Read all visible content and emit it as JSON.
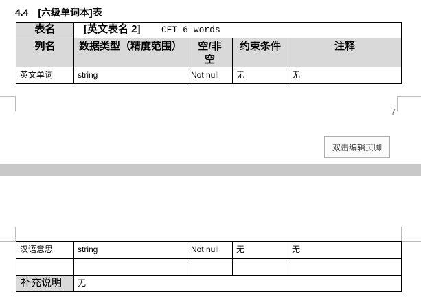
{
  "section": {
    "number": "4.4",
    "title": "[六级单词本]表"
  },
  "table": {
    "name_label": "表名",
    "table_name": "[英文表名 2]",
    "english_name": "CET-6 words",
    "headers": [
      "列名",
      "数据类型（精度范围）",
      "空/非空",
      "约束条件",
      "注释"
    ],
    "rows_page1": [
      [
        "英文单词",
        "string",
        "Not null",
        "无",
        "无"
      ]
    ],
    "rows_page2": [
      [
        "汉语意思",
        "string",
        "Not null",
        "无",
        "无"
      ],
      [
        "",
        "",
        "",
        "",
        ""
      ]
    ],
    "note_label": "补充说明",
    "note_value": "无"
  },
  "page_number": "7",
  "footer_button": "双击编辑页脚"
}
